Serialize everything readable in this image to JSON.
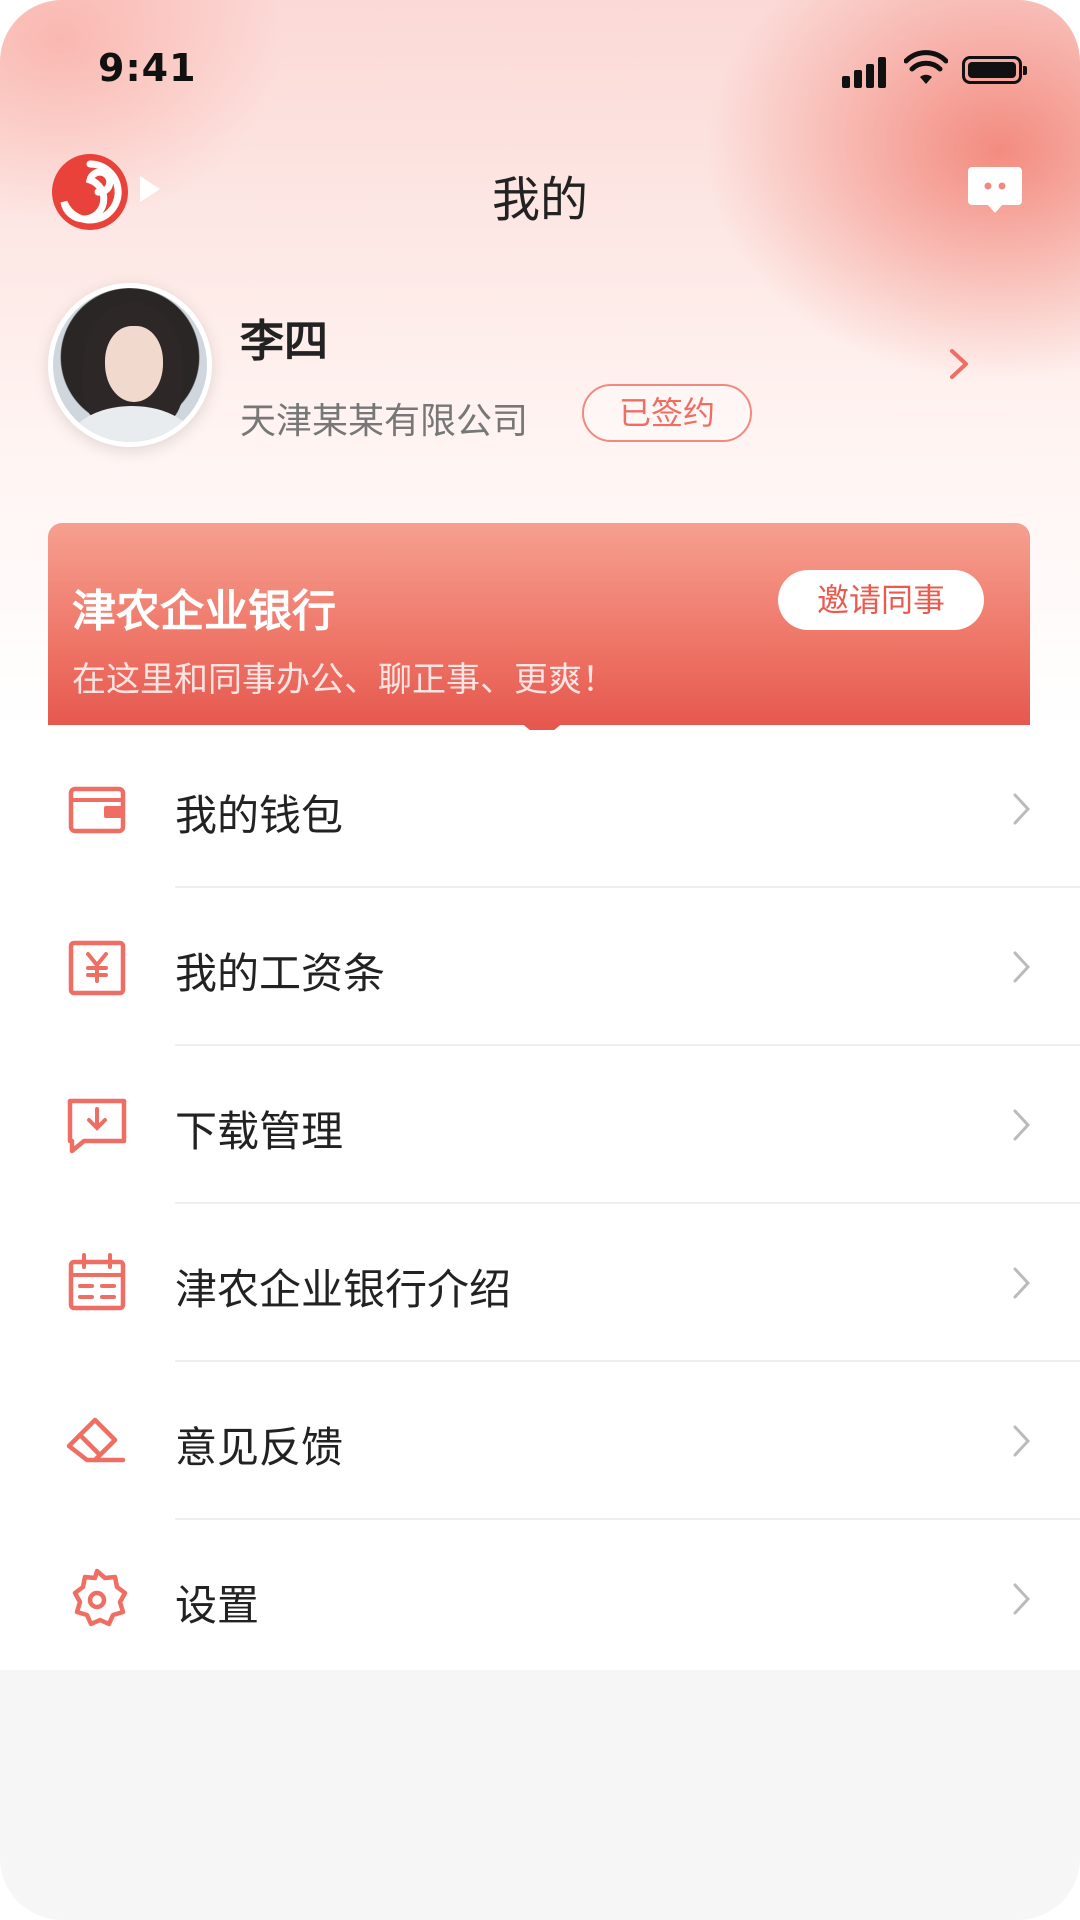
{
  "status_bar": {
    "time": "9:41"
  },
  "header": {
    "title": "我的",
    "logo_icon": "bank-logo-icon",
    "message_icon": "message-icon"
  },
  "profile": {
    "name": "李四",
    "company": "天津某某有限公司",
    "badge": "已签约"
  },
  "banner": {
    "title": "津农企业银行",
    "subtitle": "在这里和同事办公、聊正事、更爽！",
    "button": "邀请同事"
  },
  "menu": [
    {
      "label": "我的钱包",
      "icon": "wallet-icon"
    },
    {
      "label": "我的工资条",
      "icon": "payslip-icon"
    },
    {
      "label": "下载管理",
      "icon": "download-icon"
    },
    {
      "label": "津农企业银行介绍",
      "icon": "calendar-icon"
    },
    {
      "label": "意见反馈",
      "icon": "eraser-icon"
    },
    {
      "label": "设置",
      "icon": "settings-icon"
    }
  ],
  "colors": {
    "accent": "#ee6e63",
    "banner_top": "#f6a090",
    "banner_bottom": "#e6584e"
  }
}
